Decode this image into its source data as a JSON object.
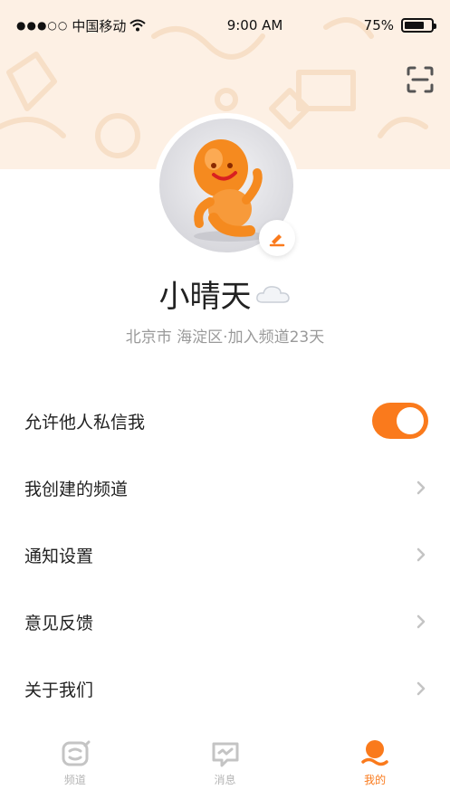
{
  "status_bar": {
    "signal": "●●●○○",
    "carrier": "中国移动",
    "time": "9:00 AM",
    "battery_percent": "75%",
    "battery_level": 0.75
  },
  "profile": {
    "name": "小晴天",
    "location_info": "北京市 海淀区·加入频道23天"
  },
  "menu": {
    "items": [
      {
        "label": "允许他人私信我",
        "toggle_on": true
      },
      {
        "label": "我创建的频道"
      },
      {
        "label": "通知设置"
      },
      {
        "label": "意见反馈"
      },
      {
        "label": "关于我们"
      }
    ]
  },
  "tabbar": {
    "tabs": [
      {
        "label": "频道",
        "icon": "channel-icon",
        "active": false
      },
      {
        "label": "消息",
        "icon": "message-icon",
        "active": false
      },
      {
        "label": "我的",
        "icon": "profile-icon",
        "active": true
      }
    ]
  },
  "colors": {
    "accent": "#fa7a1c",
    "hero_bg": "#fdf0e4",
    "inactive": "#b5b5b5"
  }
}
